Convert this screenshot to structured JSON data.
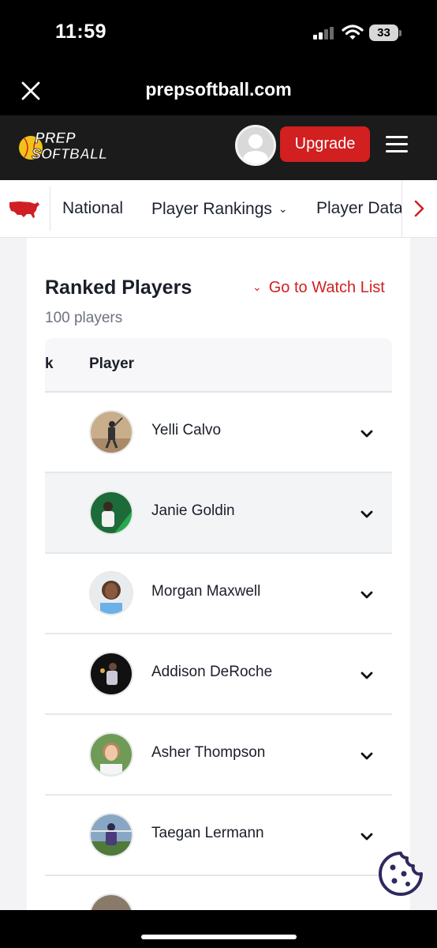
{
  "status_bar": {
    "time": "11:59",
    "battery": "33",
    "icons": [
      "signal-icon",
      "wifi-icon",
      "battery-icon"
    ]
  },
  "browser": {
    "domain": "prepsoftball.com",
    "close_icon": "close-icon"
  },
  "header": {
    "logo_line1": "PREP",
    "logo_line2": "SOFTBALL",
    "upgrade_label": "Upgrade",
    "menu_icon": "hamburger-menu-icon",
    "brand_color": "#d21f1f"
  },
  "nav": {
    "map_icon": "usa-map-icon",
    "items": [
      {
        "label": "National"
      },
      {
        "label": "Player Rankings"
      },
      {
        "label": "Player Data"
      }
    ],
    "scroll_icon": "chevron-right-icon"
  },
  "main": {
    "title": "Ranked Players",
    "watch_list_label": "Go to Watch List",
    "count_text": "100 players",
    "table": {
      "rank_header_fragment": "k",
      "player_header": "Player",
      "rows": [
        {
          "name": "Yelli Calvo"
        },
        {
          "name": "Janie Goldin"
        },
        {
          "name": "Morgan Maxwell"
        },
        {
          "name": "Addison DeRoche"
        },
        {
          "name": "Asher Thompson"
        },
        {
          "name": "Taegan Lermann"
        }
      ]
    }
  },
  "cookie_icon": "cookie-icon"
}
